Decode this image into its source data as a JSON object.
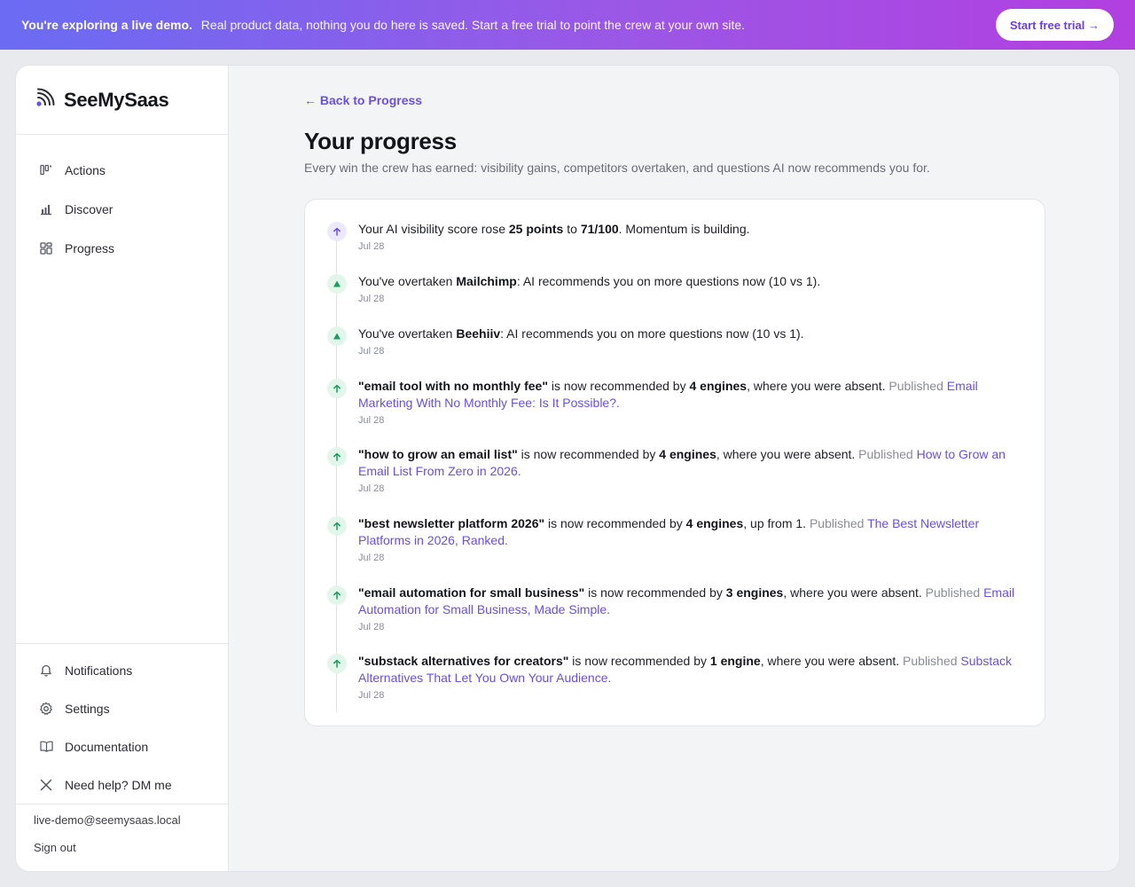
{
  "banner": {
    "bold": "You're exploring a live demo.",
    "text": "Real product data, nothing you do here is saved. Start a free trial to point the crew at your own site.",
    "cta": "Start free trial →"
  },
  "brand": {
    "name": "SeeMySaas"
  },
  "nav": [
    {
      "label": "Actions",
      "icon": "kanban-icon"
    },
    {
      "label": "Discover",
      "icon": "bar-chart-icon"
    },
    {
      "label": "Progress",
      "icon": "grid-icon"
    }
  ],
  "bottom_nav": [
    {
      "label": "Notifications",
      "icon": "bell-icon"
    },
    {
      "label": "Settings",
      "icon": "gear-icon"
    },
    {
      "label": "Documentation",
      "icon": "book-icon"
    },
    {
      "label": "Need help? DM me",
      "icon": "x-logo-icon"
    }
  ],
  "account": {
    "email": "live-demo@seemysaas.local",
    "signout": "Sign out"
  },
  "page": {
    "back": "← Back to Progress",
    "title": "Your progress",
    "subtitle": "Every win the crew has earned: visibility gains, competitors overtaken, and questions AI now recommends you for."
  },
  "events": [
    {
      "kind": "score",
      "icon": "arrow-up-icon",
      "pre": "Your AI visibility score rose ",
      "b1": "25 points",
      "mid": " to ",
      "b2": "71/100",
      "post": ". Momentum is building.",
      "date": "Jul 28"
    },
    {
      "kind": "overtake",
      "icon": "triangle-up-icon",
      "pre": "You've overtaken ",
      "b1": "Mailchimp",
      "post": ": AI recommends you on more questions now (10 vs 1).",
      "date": "Jul 28"
    },
    {
      "kind": "overtake",
      "icon": "triangle-up-icon",
      "pre": "You've overtaken ",
      "b1": "Beehiiv",
      "post": ": AI recommends you on more questions now (10 vs 1).",
      "date": "Jul 28"
    },
    {
      "kind": "query",
      "icon": "arrow-up-icon",
      "b1": "\"email tool with no monthly fee\"",
      "mid": " is now recommended by ",
      "b2": "4 engines",
      "post": ", where you were absent.",
      "pub": " Published ",
      "link": "Email Marketing With No Monthly Fee: Is It Possible?.",
      "date": "Jul 28"
    },
    {
      "kind": "query",
      "icon": "arrow-up-icon",
      "b1": "\"how to grow an email list\"",
      "mid": " is now recommended by ",
      "b2": "4 engines",
      "post": ", where you were absent.",
      "pub": " Published ",
      "link": "How to Grow an Email List From Zero in 2026.",
      "date": "Jul 28"
    },
    {
      "kind": "query",
      "icon": "arrow-up-icon",
      "b1": "\"best newsletter platform 2026\"",
      "mid": " is now recommended by ",
      "b2": "4 engines",
      "post": ", up from 1.",
      "pub": " Published ",
      "link": "The Best Newsletter Platforms in 2026, Ranked.",
      "date": "Jul 28"
    },
    {
      "kind": "query",
      "icon": "arrow-up-icon",
      "b1": "\"email automation for small business\"",
      "mid": " is now recommended by ",
      "b2": "3 engines",
      "post": ", where you were absent.",
      "pub": " Published ",
      "link": "Email Automation for Small Business, Made Simple.",
      "date": "Jul 28"
    },
    {
      "kind": "query",
      "icon": "arrow-up-icon",
      "b1": "\"substack alternatives for creators\"",
      "mid": " is now recommended by ",
      "b2": "1 engine",
      "post": ", where you were absent.",
      "pub": " Published ",
      "link": "Substack Alternatives That Let You Own Your Audience.",
      "date": "Jul 28"
    }
  ],
  "colors": {
    "accent": "#6b4fe0",
    "success": "#1b9c5f",
    "banner_start": "#6a6cf3",
    "banner_end": "#b23fe0"
  }
}
